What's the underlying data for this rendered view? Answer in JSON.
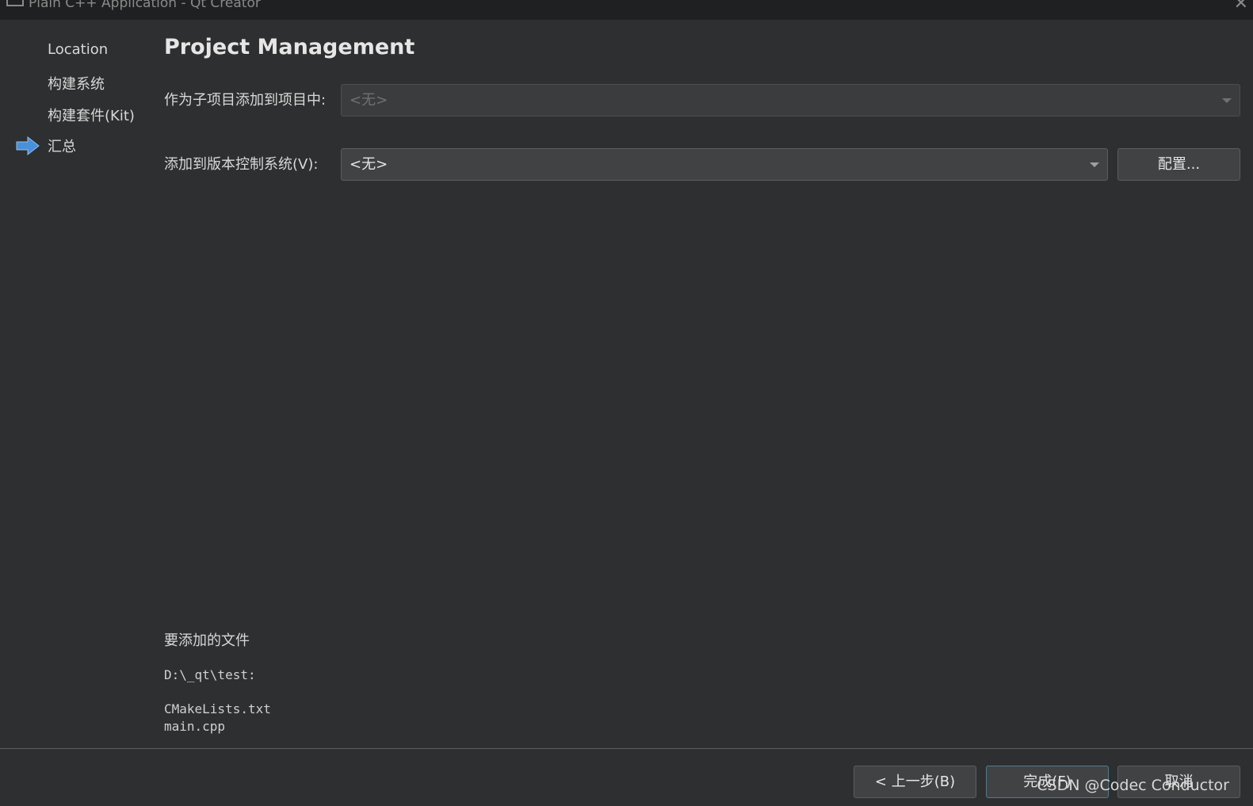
{
  "window": {
    "title": "Plain C++ Application - Qt Creator"
  },
  "steps": [
    {
      "label": "Location"
    },
    {
      "label": "构建系统"
    },
    {
      "label": "构建套件(Kit)"
    },
    {
      "label": "汇总",
      "current": true
    }
  ],
  "page": {
    "title": "Project Management"
  },
  "form": {
    "subproject_label": "作为子项目添加到项目中:",
    "subproject_value": "<无>",
    "vcs_label": "添加到版本控制系统(V):",
    "vcs_value": "<无>",
    "configure_label": "配置..."
  },
  "files": {
    "heading": "要添加的文件",
    "directory": "D:\\_qt\\test:",
    "list": [
      "CMakeLists.txt",
      "main.cpp"
    ]
  },
  "footer": {
    "back_label": "< 上一步(B)",
    "finish_label": "完成(F)",
    "cancel_label": "取消"
  },
  "watermark": "CSDN @Codec Conductor",
  "colors": {
    "arrow": "#4a90d9",
    "background": "#2e2f30"
  }
}
